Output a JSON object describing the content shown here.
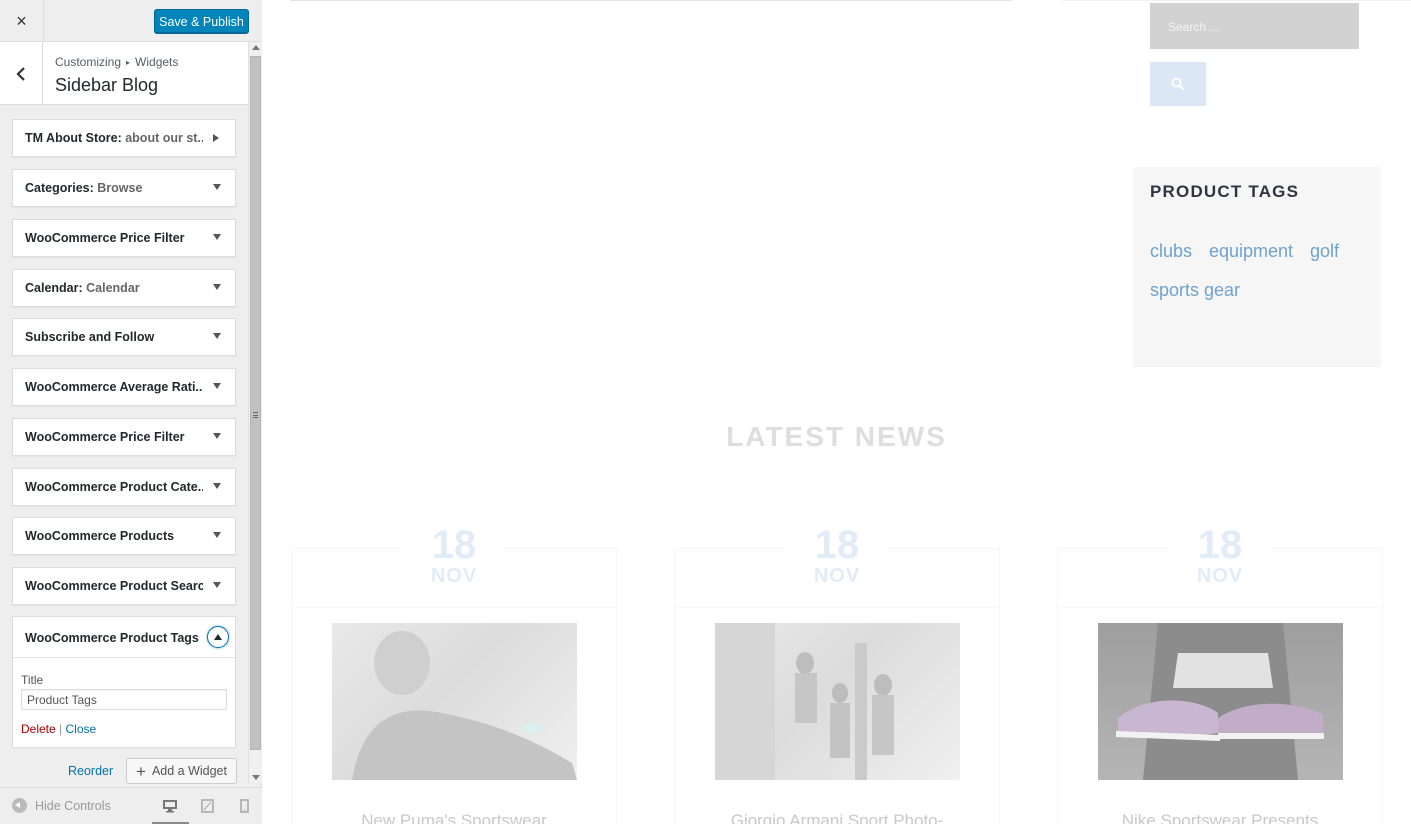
{
  "topbar": {
    "close_symbol": "×",
    "save_label": "Save & Publish"
  },
  "section": {
    "breadcrumb_parent": "Customizing",
    "breadcrumb_separator": "▸",
    "breadcrumb_child": "Widgets",
    "title": "Sidebar Blog"
  },
  "widgets": [
    {
      "name": "TM About Store",
      "suffix": "about our st..."
    },
    {
      "name": "Categories",
      "suffix": "Browse"
    },
    {
      "name": "WooCommerce Price Filter",
      "suffix": ""
    },
    {
      "name": "Calendar",
      "suffix": "Calendar"
    },
    {
      "name": "Subscribe and Follow",
      "suffix": ""
    },
    {
      "name": "WooCommerce Average Rati...",
      "suffix": ""
    },
    {
      "name": "WooCommerce Price Filter",
      "suffix": ""
    },
    {
      "name": "WooCommerce Product Cate...",
      "suffix": ""
    },
    {
      "name": "WooCommerce Products",
      "suffix": ""
    },
    {
      "name": "WooCommerce Product Search",
      "suffix": ""
    }
  ],
  "expanded_widget": {
    "name": "WooCommerce Product Tags",
    "title_label": "Title",
    "title_value": "Product Tags",
    "delete_label": "Delete",
    "separator": "|",
    "close_label": "Close"
  },
  "actions": {
    "reorder_label": "Reorder",
    "add_widget_label": "Add a Widget"
  },
  "footer": {
    "hide_controls_label": "Hide Controls",
    "active_device": "desktop"
  },
  "preview": {
    "search_placeholder": "Search ...",
    "tags_heading": "PRODUCT TAGS",
    "tags": [
      "clubs",
      "equipment",
      "golf",
      "sports gear"
    ],
    "latest_news_heading": "LATEST NEWS",
    "posts": [
      {
        "day": "18",
        "month": "NOV",
        "title": "New Puma's Sportswear"
      },
      {
        "day": "18",
        "month": "NOV",
        "title": "Giorgio Armani Sport Photo-"
      },
      {
        "day": "18",
        "month": "NOV",
        "title": "Nike Sportswear Presents"
      }
    ]
  },
  "colors": {
    "primary_button": "#0085ba",
    "link": "#0073aa",
    "delete": "#aa0000",
    "tag_link": "#6fa2cd"
  }
}
